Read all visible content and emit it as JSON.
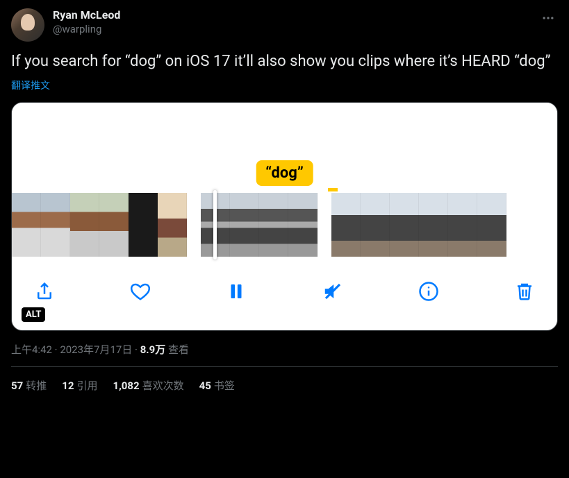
{
  "user": {
    "display_name": "Ryan McLeod",
    "handle": "@warpling"
  },
  "body": "If you search for “dog” on iOS 17 it’ll also show you clips where it’s HEARD “dog”",
  "translate": "翻译推文",
  "media": {
    "bubble": "“dog”",
    "alt_badge": "ALT"
  },
  "meta": {
    "time": "上午4:42",
    "sep1": " · ",
    "date": "2023年7月17日",
    "sep2": " · ",
    "views_count": "8.9万",
    "views_label": " 查看"
  },
  "stats": {
    "retweets_count": "57",
    "retweets_label": "转推",
    "quotes_count": "12",
    "quotes_label": "引用",
    "likes_count": "1,082",
    "likes_label": "喜欢次数",
    "bookmarks_count": "45",
    "bookmarks_label": "书签"
  }
}
